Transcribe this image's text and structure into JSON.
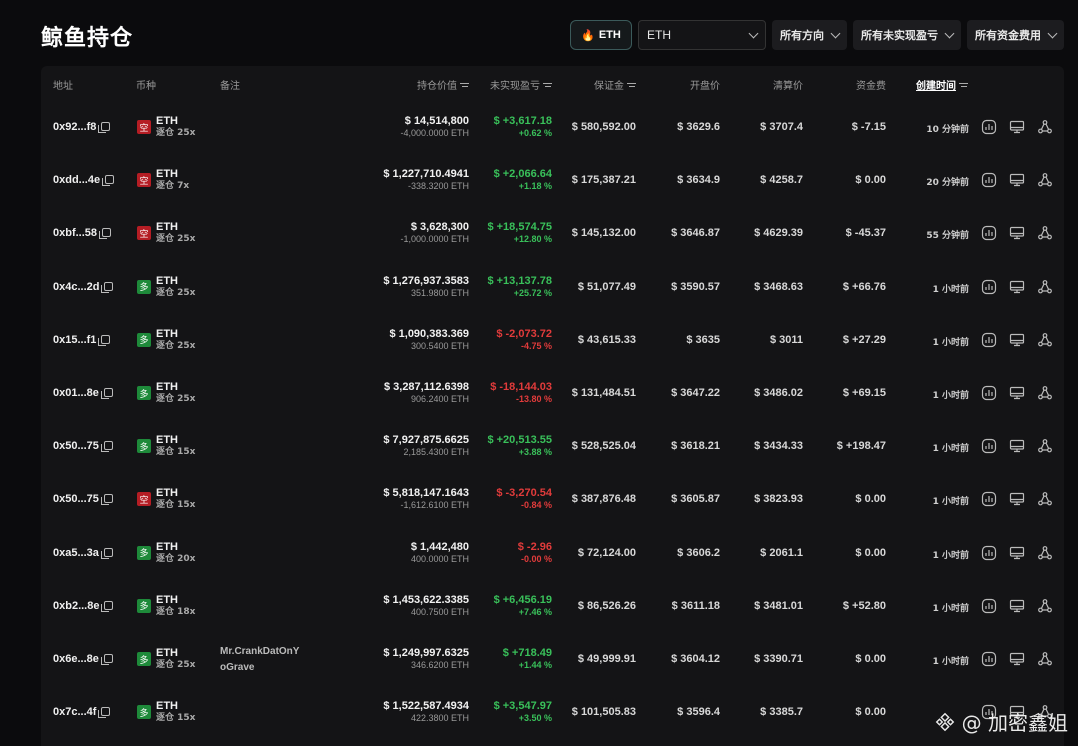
{
  "page_title": "鲸鱼持仓",
  "filters": {
    "eth_chip": "ETH",
    "coin_select": "ETH",
    "direction": "所有方向",
    "unrealized": "所有未实现盈亏",
    "funding": "所有资金费用"
  },
  "columns": {
    "address": "地址",
    "coin": "币种",
    "note": "备注",
    "value": "持仓价值",
    "pnl": "未实现盈亏",
    "margin": "保证金",
    "entry": "开盘价",
    "liq": "清算价",
    "funding": "资金费",
    "created": "创建时间"
  },
  "rows": [
    {
      "address": "0x92...f8",
      "side": "空",
      "side_type": "short",
      "coin": "ETH",
      "leverage": "逐仓 25x",
      "note1": "",
      "note2": "",
      "value": "$ 14,514,800",
      "size": "-4,000.0000 ETH",
      "pnl": "$ +3,617.18",
      "pnl_pct": "+0.62 %",
      "pnl_type": "pos",
      "margin": "$ 580,592.00",
      "entry": "$ 3629.6",
      "liq": "$ 3707.4",
      "funding": "$ -7.15",
      "funding_type": "neg",
      "created": "10 分钟前"
    },
    {
      "address": "0xdd...4e",
      "side": "空",
      "side_type": "short",
      "coin": "ETH",
      "leverage": "逐仓 7x",
      "note1": "",
      "note2": "",
      "value": "$ 1,227,710.4941",
      "size": "-338.3200 ETH",
      "pnl": "$ +2,066.64",
      "pnl_pct": "+1.18 %",
      "pnl_type": "pos",
      "margin": "$ 175,387.21",
      "entry": "$ 3634.9",
      "liq": "$ 4258.7",
      "funding": "$ 0.00",
      "funding_type": "zero",
      "created": "20 分钟前"
    },
    {
      "address": "0xbf...58",
      "side": "空",
      "side_type": "short",
      "coin": "ETH",
      "leverage": "逐仓 25x",
      "note1": "",
      "note2": "",
      "value": "$ 3,628,300",
      "size": "-1,000.0000 ETH",
      "pnl": "$ +18,574.75",
      "pnl_pct": "+12.80 %",
      "pnl_type": "pos",
      "margin": "$ 145,132.00",
      "entry": "$ 3646.87",
      "liq": "$ 4629.39",
      "funding": "$ -45.37",
      "funding_type": "neg",
      "created": "55 分钟前"
    },
    {
      "address": "0x4c...2d",
      "side": "多",
      "side_type": "long",
      "coin": "ETH",
      "leverage": "逐仓 25x",
      "note1": "",
      "note2": "",
      "value": "$ 1,276,937.3583",
      "size": "351.9800 ETH",
      "pnl": "$ +13,137.78",
      "pnl_pct": "+25.72 %",
      "pnl_type": "pos",
      "margin": "$ 51,077.49",
      "entry": "$ 3590.57",
      "liq": "$ 3468.63",
      "funding": "$ +66.76",
      "funding_type": "pos",
      "created": "1 小时前"
    },
    {
      "address": "0x15...f1",
      "side": "多",
      "side_type": "long",
      "coin": "ETH",
      "leverage": "逐仓 25x",
      "note1": "",
      "note2": "",
      "value": "$ 1,090,383.369",
      "size": "300.5400 ETH",
      "pnl": "$ -2,073.72",
      "pnl_pct": "-4.75 %",
      "pnl_type": "neg",
      "margin": "$ 43,615.33",
      "entry": "$ 3635",
      "liq": "$ 3011",
      "funding": "$ +27.29",
      "funding_type": "pos",
      "created": "1 小时前"
    },
    {
      "address": "0x01...8e",
      "side": "多",
      "side_type": "long",
      "coin": "ETH",
      "leverage": "逐仓 25x",
      "note1": "",
      "note2": "",
      "value": "$ 3,287,112.6398",
      "size": "906.2400 ETH",
      "pnl": "$ -18,144.03",
      "pnl_pct": "-13.80 %",
      "pnl_type": "neg",
      "margin": "$ 131,484.51",
      "entry": "$ 3647.22",
      "liq": "$ 3486.02",
      "funding": "$ +69.15",
      "funding_type": "pos",
      "created": "1 小时前"
    },
    {
      "address": "0x50...75",
      "side": "多",
      "side_type": "long",
      "coin": "ETH",
      "leverage": "逐仓 15x",
      "note1": "",
      "note2": "",
      "value": "$ 7,927,875.6625",
      "size": "2,185.4300 ETH",
      "pnl": "$ +20,513.55",
      "pnl_pct": "+3.88 %",
      "pnl_type": "pos",
      "margin": "$ 528,525.04",
      "entry": "$ 3618.21",
      "liq": "$ 3434.33",
      "funding": "$ +198.47",
      "funding_type": "pos",
      "created": "1 小时前"
    },
    {
      "address": "0x50...75",
      "side": "空",
      "side_type": "short",
      "coin": "ETH",
      "leverage": "逐仓 15x",
      "note1": "",
      "note2": "",
      "value": "$ 5,818,147.1643",
      "size": "-1,612.6100 ETH",
      "pnl": "$ -3,270.54",
      "pnl_pct": "-0.84 %",
      "pnl_type": "neg",
      "margin": "$ 387,876.48",
      "entry": "$ 3605.87",
      "liq": "$ 3823.93",
      "funding": "$ 0.00",
      "funding_type": "zero",
      "created": "1 小时前"
    },
    {
      "address": "0xa5...3a",
      "side": "多",
      "side_type": "long",
      "coin": "ETH",
      "leverage": "逐仓 20x",
      "note1": "",
      "note2": "",
      "value": "$ 1,442,480",
      "size": "400.0000 ETH",
      "pnl": "$ -2.96",
      "pnl_pct": "-0.00 %",
      "pnl_type": "neg",
      "margin": "$ 72,124.00",
      "entry": "$ 3606.2",
      "liq": "$ 2061.1",
      "funding": "$ 0.00",
      "funding_type": "zero",
      "created": "1 小时前"
    },
    {
      "address": "0xb2...8e",
      "side": "多",
      "side_type": "long",
      "coin": "ETH",
      "leverage": "逐仓 18x",
      "note1": "",
      "note2": "",
      "value": "$ 1,453,622.3385",
      "size": "400.7500 ETH",
      "pnl": "$ +6,456.19",
      "pnl_pct": "+7.46 %",
      "pnl_type": "pos",
      "margin": "$ 86,526.26",
      "entry": "$ 3611.18",
      "liq": "$ 3481.01",
      "funding": "$ +52.80",
      "funding_type": "pos",
      "created": "1 小时前"
    },
    {
      "address": "0x6e...8e",
      "side": "多",
      "side_type": "long",
      "coin": "ETH",
      "leverage": "逐仓 25x",
      "note1": "Mr.CrankDatOnY",
      "note2": "oGrave",
      "value": "$ 1,249,997.6325",
      "size": "346.6200 ETH",
      "pnl": "$ +718.49",
      "pnl_pct": "+1.44 %",
      "pnl_type": "pos",
      "margin": "$ 49,999.91",
      "entry": "$ 3604.12",
      "liq": "$ 3390.71",
      "funding": "$ 0.00",
      "funding_type": "zero",
      "created": "1 小时前"
    },
    {
      "address": "0x7c...4f",
      "side": "多",
      "side_type": "long",
      "coin": "ETH",
      "leverage": "逐仓 15x",
      "note1": "",
      "note2": "",
      "value": "$ 1,522,587.4934",
      "size": "422.3800 ETH",
      "pnl": "$ +3,547.97",
      "pnl_pct": "+3.50 %",
      "pnl_type": "pos",
      "margin": "$ 101,505.83",
      "entry": "$ 3596.4",
      "liq": "$ 3385.7",
      "funding": "$ 0.00",
      "funding_type": "zero",
      "created": ""
    }
  ],
  "watermark": "@ 加密鑫姐",
  "colors": {
    "positive": "#39c05a",
    "negative": "#e23b3b",
    "short_badge": "#b51d24",
    "long_badge": "#1e8a3a",
    "background": "#0b0b0d",
    "table_bg": "#141416"
  },
  "icons": {
    "chart": "chart-icon",
    "monitor": "monitor-icon",
    "share": "share-icon",
    "copy": "copy-icon",
    "flame": "flame-icon"
  }
}
